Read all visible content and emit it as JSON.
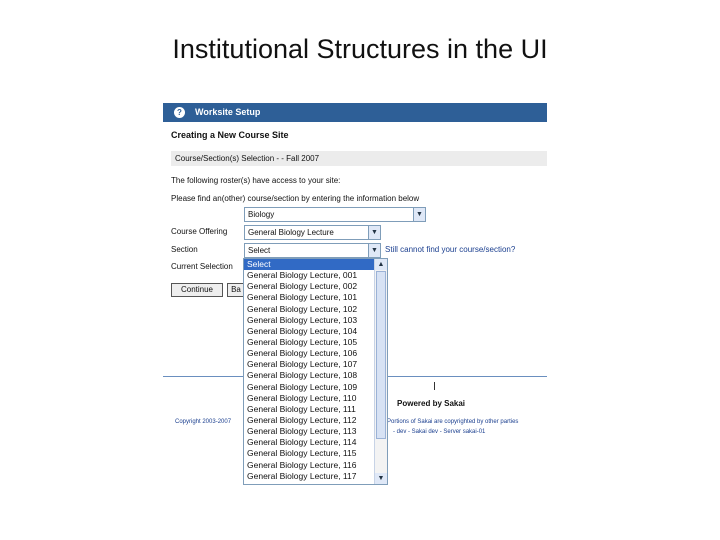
{
  "slide": {
    "title": "Institutional Structures in the UI"
  },
  "window": {
    "title": "Worksite Setup",
    "icon": "help-icon"
  },
  "page": {
    "heading": "Creating a New Course Site",
    "section_band": "Course/Section(s) Selection - - Fall 2007",
    "roster_text": "The following roster(s) have access to your site:",
    "instructions": "Please find an(other) course/section by entering the information below",
    "subject_value": "Biology",
    "course_offering_label": "Course Offering",
    "course_offering_value": "General Biology Lecture",
    "section_label": "Section",
    "section_value": "Select",
    "current_selection_label": "Current Selection",
    "cant_find_link": "Still cannot find your course/section?",
    "continue_button": "Continue",
    "back_button": "Ba"
  },
  "footer": {
    "powered_by": "Powered by Sakai",
    "copyright": "Copyright 2003-2007",
    "rights": "Portions of Sakai are copyrighted by other parties",
    "links": "- dev - Sakai dev - Server sakai-01"
  },
  "section_options": [
    "Select",
    "General Biology Lecture, 001",
    "General Biology Lecture, 002",
    "General Biology Lecture, 101",
    "General Biology Lecture, 102",
    "General Biology Lecture, 103",
    "General Biology Lecture, 104",
    "General Biology Lecture, 105",
    "General Biology Lecture, 106",
    "General Biology Lecture, 107",
    "General Biology Lecture, 108",
    "General Biology Lecture, 109",
    "General Biology Lecture, 110",
    "General Biology Lecture, 111",
    "General Biology Lecture, 112",
    "General Biology Lecture, 113",
    "General Biology Lecture, 114",
    "General Biology Lecture, 115",
    "General Biology Lecture, 116",
    "General Biology Lecture, 117"
  ],
  "selected_option": "Select",
  "colors": {
    "titlebar": "#2e5f97",
    "highlight": "#316ac5",
    "link": "#1b3f8f"
  }
}
